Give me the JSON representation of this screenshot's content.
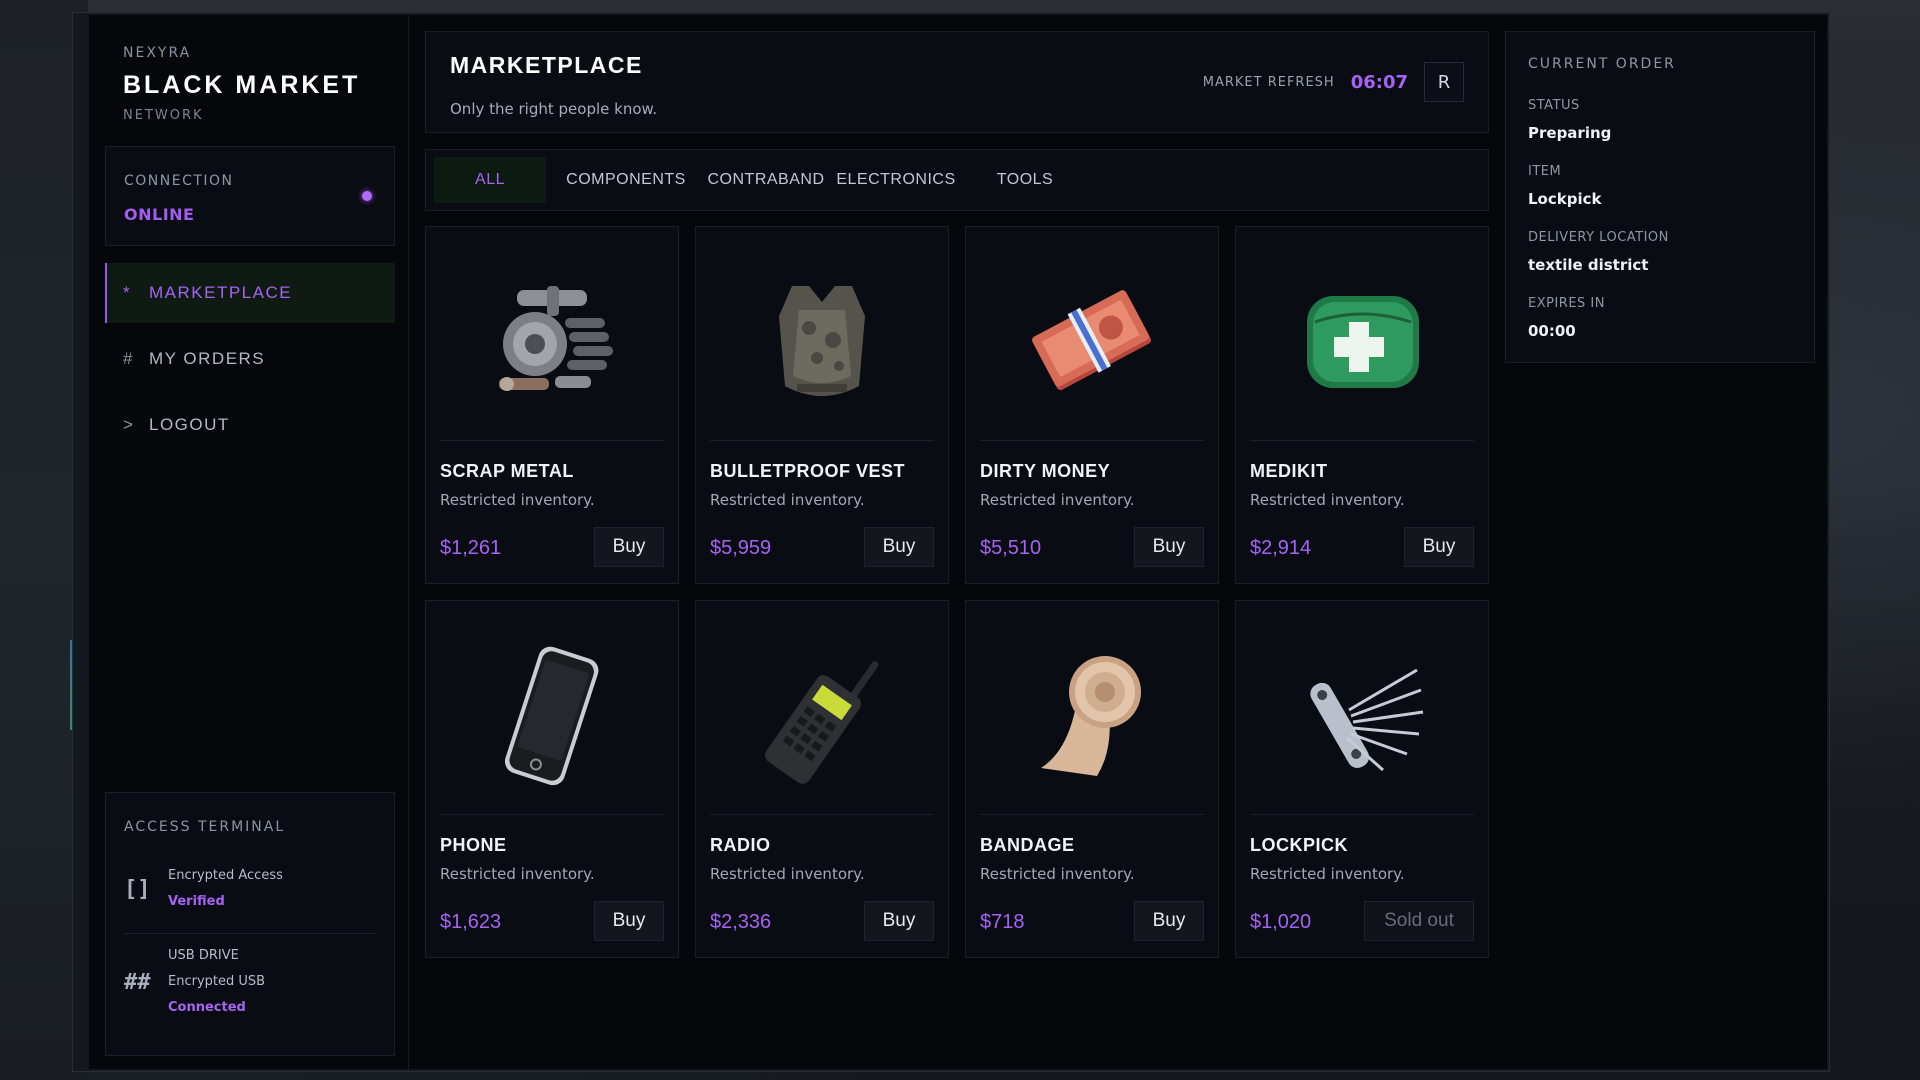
{
  "brand": {
    "over": "NEXYRA",
    "title": "BLACK MARKET",
    "under": "NETWORK"
  },
  "connection": {
    "label": "CONNECTION",
    "value": "ONLINE"
  },
  "nav": [
    {
      "glyph": "*",
      "label": "MARKETPLACE",
      "active": true
    },
    {
      "glyph": "#",
      "label": "MY ORDERS",
      "active": false
    },
    {
      "glyph": ">",
      "label": "LOGOUT",
      "active": false
    }
  ],
  "terminal": {
    "heading": "ACCESS TERMINAL",
    "rows": [
      {
        "icon": "[]",
        "title": "Encrypted Access",
        "status": "Verified"
      },
      {
        "icon": "##",
        "title": "USB DRIVE",
        "subtitle": "Encrypted USB",
        "status": "Connected"
      }
    ]
  },
  "header": {
    "title": "MARKETPLACE",
    "subtitle": "Only the right people know.",
    "refresh_label": "MARKET REFRESH",
    "refresh_time": "06:07",
    "refresh_button": "R"
  },
  "tabs": [
    "ALL",
    "COMPONENTS",
    "CONTRABAND",
    "ELECTRONICS",
    "TOOLS"
  ],
  "items": [
    {
      "icon": "scrap-metal-icon",
      "name": "SCRAP METAL",
      "desc": "Restricted inventory.",
      "price": "$1,261",
      "action": "Buy"
    },
    {
      "icon": "bulletproof-vest-icon",
      "name": "BULLETPROOF VEST",
      "desc": "Restricted inventory.",
      "price": "$5,959",
      "action": "Buy"
    },
    {
      "icon": "dirty-money-icon",
      "name": "DIRTY MONEY",
      "desc": "Restricted inventory.",
      "price": "$5,510",
      "action": "Buy"
    },
    {
      "icon": "medikit-icon",
      "name": "MEDIKIT",
      "desc": "Restricted inventory.",
      "price": "$2,914",
      "action": "Buy"
    },
    {
      "icon": "phone-icon",
      "name": "PHONE",
      "desc": "Restricted inventory.",
      "price": "$1,623",
      "action": "Buy"
    },
    {
      "icon": "radio-icon",
      "name": "RADIO",
      "desc": "Restricted inventory.",
      "price": "$2,336",
      "action": "Buy"
    },
    {
      "icon": "bandage-icon",
      "name": "BANDAGE",
      "desc": "Restricted inventory.",
      "price": "$718",
      "action": "Buy"
    },
    {
      "icon": "lockpick-icon",
      "name": "LOCKPICK",
      "desc": "Restricted inventory.",
      "price": "$1,020",
      "action": "Sold out",
      "sold_out": true
    }
  ],
  "order": {
    "heading": "CURRENT ORDER",
    "status_label": "STATUS",
    "status": "Preparing",
    "item_label": "ITEM",
    "item": "Lockpick",
    "location_label": "DELIVERY LOCATION",
    "location": "textile district",
    "expires_label": "EXPIRES IN",
    "expires": "00:00"
  },
  "colors": {
    "accent": "#a663f3",
    "background": "#05070b",
    "panel": "#090c12",
    "active_bg": "#0e1a12"
  }
}
